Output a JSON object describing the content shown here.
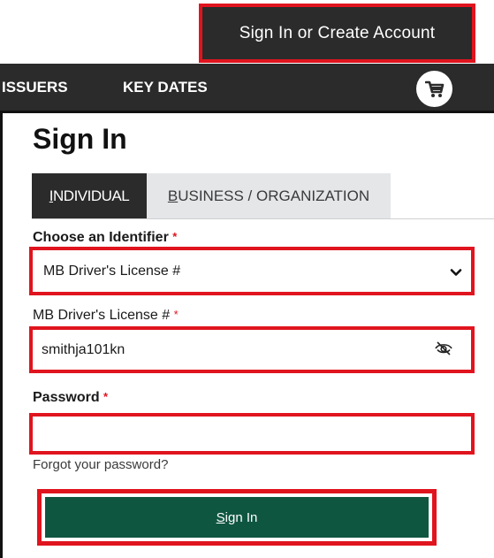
{
  "header": {
    "account_button": "Sign In or Create Account"
  },
  "nav": {
    "items": [
      {
        "label": "ISSUERS"
      },
      {
        "label": "KEY DATES"
      }
    ],
    "cart_icon": "shopping-cart-icon"
  },
  "page": {
    "title": "Sign In"
  },
  "tabs": [
    {
      "label_first": "I",
      "label_rest": "NDIVIDUAL",
      "active": true
    },
    {
      "label_first": "B",
      "label_rest": "USINESS / ORGANIZATION",
      "active": false
    }
  ],
  "form": {
    "identifier": {
      "label": "Choose an Identifier",
      "required_mark": "*",
      "selected_value": "MB Driver's License #"
    },
    "license": {
      "label": "MB Driver's License #",
      "required_mark": "*",
      "value": "smithja101kn",
      "toggle_icon": "eye-slash-icon"
    },
    "password": {
      "label": "Password",
      "required_mark": "*",
      "value": ""
    },
    "forgot_link": "Forgot your password?",
    "submit": {
      "label_first": "S",
      "label_rest": "ign In"
    }
  },
  "colors": {
    "highlight": "#e0141e",
    "dark": "#2b2b2b",
    "primary_button": "#0f5641",
    "tab_inactive": "#e4e6e8"
  }
}
